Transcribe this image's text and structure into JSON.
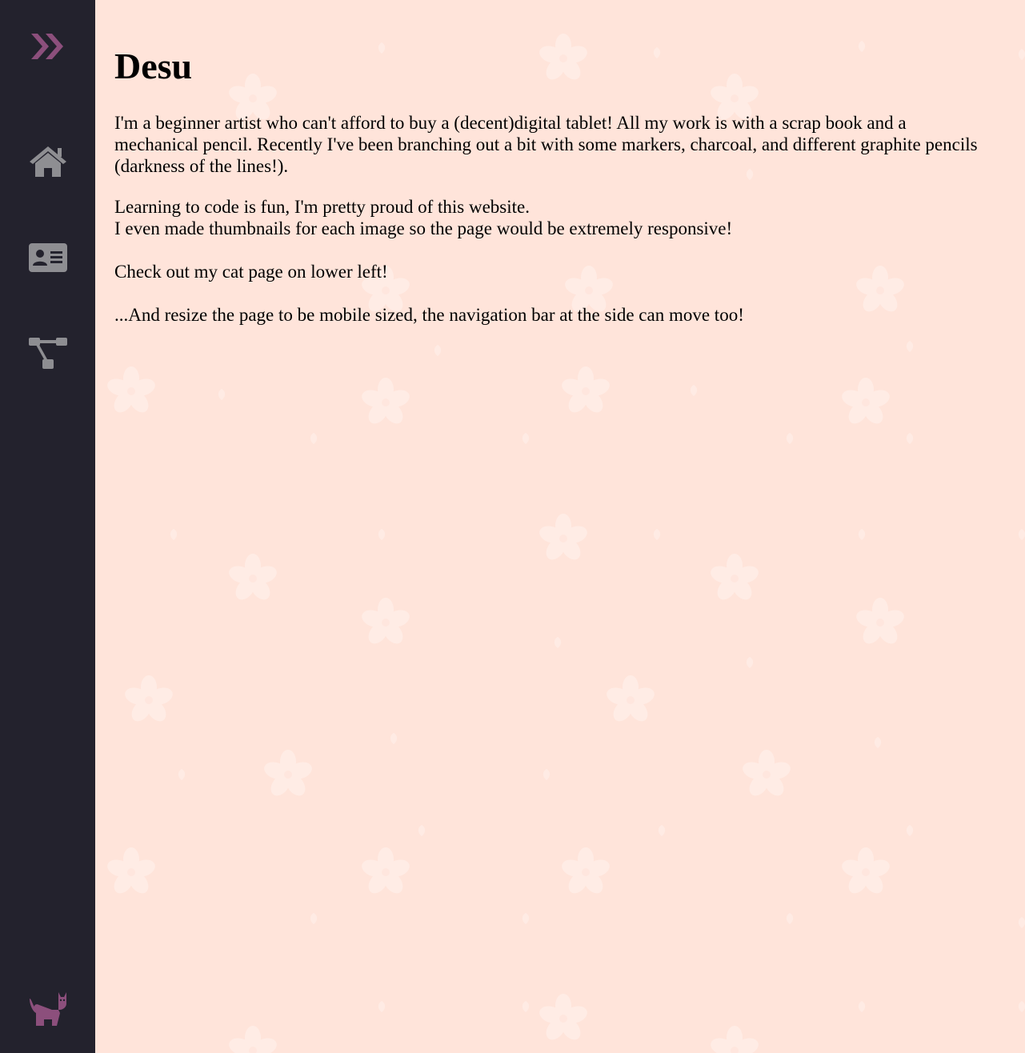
{
  "nav": {
    "items": [
      {
        "name": "expand",
        "icon": "double-chevron-right-icon"
      },
      {
        "name": "home",
        "icon": "home-icon"
      },
      {
        "name": "about",
        "icon": "id-card-icon"
      },
      {
        "name": "sitemap",
        "icon": "sitemap-icon"
      },
      {
        "name": "cats",
        "icon": "cat-icon"
      }
    ],
    "accent_color": "#8c4f7c",
    "icon_color": "#8e8e92",
    "background_color": "#23222d"
  },
  "page": {
    "background_color": "#ffe4da",
    "title": "Desu",
    "paragraph1": "I'm a beginner artist who can't afford to buy a (decent)digital tablet! All my work is with a scrap book and a mechanical pencil. Recently I've been branching out a bit with some markers, charcoal, and different graphite pencils (darkness of the lines!).",
    "line1": "Learning to code is fun, I'm pretty proud of this website.",
    "line2": "I even made thumbnails for each image so the page would be extremely responsive!",
    "line3": "Check out my cat page on lower left!",
    "line4": "...And resize the page to be mobile sized, the navigation bar at the side can move too!"
  }
}
